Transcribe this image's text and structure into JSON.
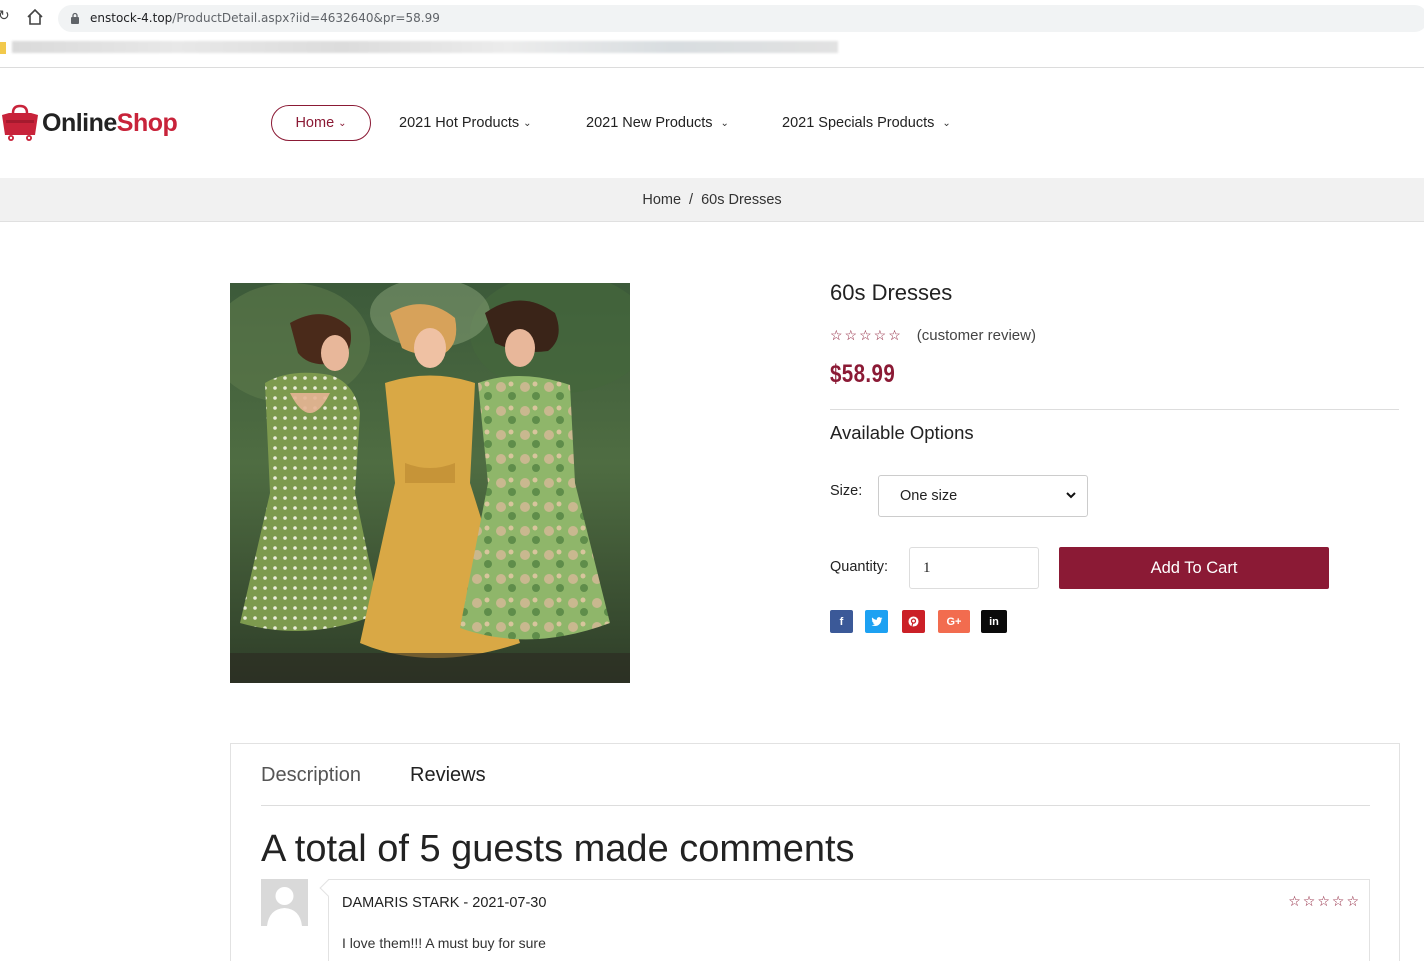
{
  "browser": {
    "url_host": "enstock-4.top",
    "url_path": "/ProductDetail.aspx?iid=4632640&pr=58.99"
  },
  "header": {
    "logo_part1": "Online",
    "logo_part2": "Shop",
    "nav": {
      "home": "Home",
      "hot": "2021 Hot Products",
      "new": "2021 New Products",
      "specials": "2021 Specials Products"
    }
  },
  "breadcrumb": {
    "home": "Home",
    "separator": "/",
    "current": "60s Dresses"
  },
  "product": {
    "title": "60s Dresses",
    "rating_stars": "☆☆☆☆☆",
    "rating_value": 0,
    "review_label": "(customer review)",
    "price": "$58.99",
    "options_heading": "Available Options",
    "size_label": "Size:",
    "size_value": "One size",
    "quantity_label": "Quantity:",
    "quantity_value": "1",
    "add_to_cart": "Add To Cart",
    "share": {
      "facebook": "f",
      "twitter": "t",
      "pinterest": "p",
      "googleplus": "G+",
      "linkedin": "in"
    }
  },
  "tabs": {
    "description": "Description",
    "reviews": "Reviews"
  },
  "reviews": {
    "heading": "A total of 5 guests made comments",
    "items": [
      {
        "author": "DAMARIS STARK",
        "separator": " - ",
        "date": "2021-07-30",
        "stars": "☆☆☆☆☆",
        "text": "I love them!!! A must buy for sure"
      }
    ]
  },
  "colors": {
    "accent": "#8b1a35",
    "logo_red": "#c8233a",
    "facebook": "#3b5998",
    "twitter": "#1da1f2",
    "pinterest": "#cb2027",
    "googleplus": "#f26c4f",
    "linkedin": "#0a0a0a"
  }
}
